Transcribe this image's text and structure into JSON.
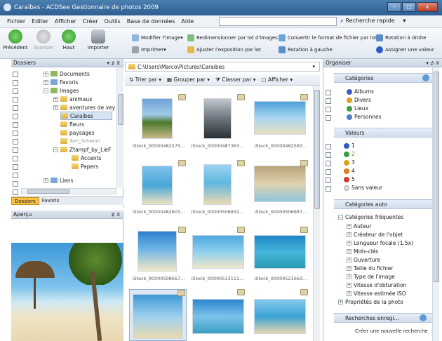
{
  "window": {
    "title": "Caraibes - ACDSee Gestionnaire de photos 2009",
    "min": "–",
    "max": "□",
    "close": "x"
  },
  "menu": [
    "Fichier",
    "Editer",
    "Afficher",
    "Créer",
    "Outils",
    "Base de données",
    "Aide"
  ],
  "quick_search": "Recherche rapide",
  "toolbar": {
    "big": [
      "Précédent",
      "Avancer",
      "Haut",
      "Importer"
    ],
    "small": [
      "Modifier l'image",
      "Redimensionner par lot d'images",
      "Convertir le format de fichier par lot",
      "Rotation à droite",
      "Imprimer",
      "Ajuster l'exposition par lot",
      "Rotation à gauche",
      "Assigner une valeur"
    ]
  },
  "folders": {
    "title": "Dossiers",
    "controls": "▾ ⊅ X",
    "tree": [
      "Documents",
      "Favoris",
      "Images",
      "animaux",
      "aventures de vey",
      "Caraibes",
      "fleurs",
      "paysages",
      "Tom_Schwinn",
      "Ztampf_by_LieF",
      "Accents",
      "Papers",
      "Liens"
    ],
    "tabs": [
      "Dossiers",
      "Favoris"
    ]
  },
  "preview": {
    "title": "Aperçu",
    "controls": "⊅ X"
  },
  "path": "C:\\Users\\Marco\\Pictures\\Caraibes",
  "browser_toolbar": [
    "Trier par",
    "Grouper par",
    "Classer par",
    "Afficher"
  ],
  "captions": [
    "iStock_00000482575...",
    "iStock_00000487363...",
    "iStock_00000482583...",
    "iStock_00000482603...",
    "iStock_00000506832...",
    "iStock_00000506987...",
    "iStock_00000508667...",
    "iStock_00000513111...",
    "iStock_00000521663..."
  ],
  "organizer": {
    "title": "Organiser",
    "controls": "▾ ⊅ X",
    "categories_title": "Catégories",
    "categories": [
      "Albums",
      "Divers",
      "Lieux",
      "Personnes"
    ],
    "ratings_title": "Valeurs",
    "ratings": [
      "1",
      "2",
      "3",
      "4",
      "5",
      "Sans valeur"
    ],
    "rating_colors": [
      "#2f58c8",
      "#3a9a3a",
      "#d9a520",
      "#e07a1e",
      "#d03a2a",
      "#e0e0e0"
    ],
    "auto_title": "Catégories auto",
    "auto_root": "Catégories fréquentes",
    "auto_items": [
      "Auteur",
      "Créateur de l'objet",
      "Longueur focale (1.5x)",
      "Mots-clés",
      "Ouverture",
      "Taille du fichier",
      "Type de l'image",
      "Vitesse d'obturation",
      "Vitesse estimée ISO"
    ],
    "auto_props": "Propriétés de la photo",
    "saved_title": "Recherches enregi...",
    "saved_item": "Créer une nouvelle recherche"
  }
}
